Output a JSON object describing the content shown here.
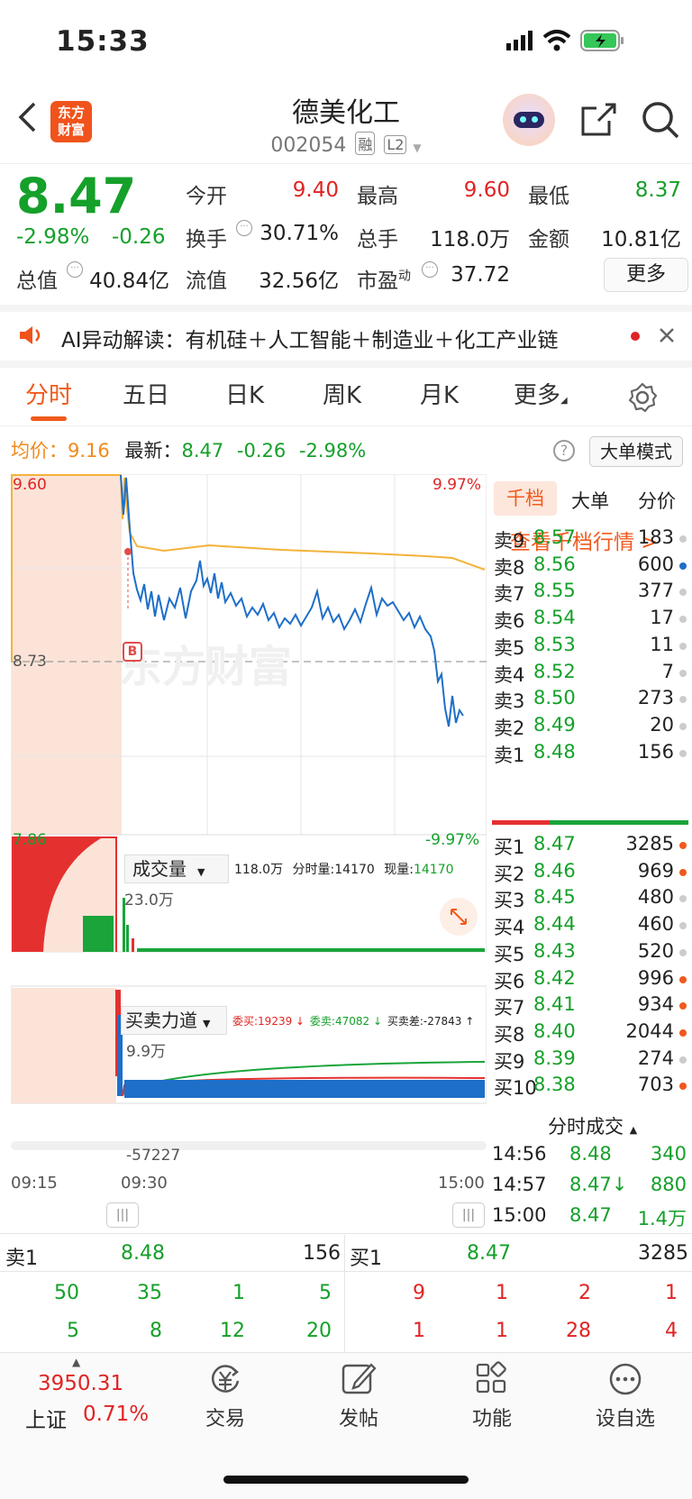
{
  "status": {
    "time": "15:33"
  },
  "header": {
    "logo_line1": "东方",
    "logo_line2": "财富",
    "stock_name": "德美化工",
    "stock_code": "002054",
    "tag_margin": "融",
    "tag_level": "L2"
  },
  "quote": {
    "price": "8.47",
    "change_pct": "-2.98%",
    "change": "-0.26",
    "open_label": "今开",
    "open": "9.40",
    "high_label": "最高",
    "high": "9.60",
    "low_label": "最低",
    "low": "8.37",
    "turnover_label": "换手",
    "turnover": "30.71%",
    "volume_label": "总手",
    "volume": "118.0万",
    "amount_label": "金额",
    "amount": "10.81亿",
    "mktcap_label": "总值",
    "mktcap": "40.84亿",
    "float_label": "流值",
    "float": "32.56亿",
    "pe_label": "市盈",
    "pe_sup": "动",
    "pe": "37.72",
    "more": "更多"
  },
  "ai": {
    "text": "AI异动解读：有机硅＋人工智能＋制造业＋化工产业链"
  },
  "tabs": [
    "分时",
    "五日",
    "日K",
    "周K",
    "月K",
    "更多"
  ],
  "avgline": {
    "avg_label": "均价：",
    "avg": "9.16",
    "latest_label": "最新：",
    "latest": "8.47",
    "chg": "-0.26",
    "pct": "-2.98%",
    "big_order": "大单模式"
  },
  "chart": {
    "y_high": "9.60",
    "y_mid": "8.73",
    "y_low": "7.86",
    "pct_high": "9.97%",
    "pct_low": "-9.97%",
    "watermark": "东方财富",
    "marker": "B",
    "vol_label": "成交量",
    "vol_info_total": "118.0万",
    "vol_info_tick_label": "分时量:",
    "vol_info_tick": "14170",
    "vol_info_now_label": "现量:",
    "vol_info_now": "14170",
    "vol_max": "23.0万",
    "force_label": "买卖力道",
    "force_buy": "委买:19239 ↓",
    "force_sell": "委卖:47082 ↓",
    "force_diff": "买卖差:-27843 ↑",
    "force_max": "9.9万",
    "force_min": "-57227",
    "t_start": "09:15",
    "t_open": "09:30",
    "t_end": "15:00"
  },
  "orderbook": {
    "tabs": [
      "千档",
      "大单",
      "分价"
    ],
    "link": "查看千档行情 >",
    "asks": [
      [
        "卖9",
        "8.57",
        "183"
      ],
      [
        "卖8",
        "8.56",
        "600"
      ],
      [
        "卖7",
        "8.55",
        "377"
      ],
      [
        "卖6",
        "8.54",
        "17"
      ],
      [
        "卖5",
        "8.53",
        "11"
      ],
      [
        "卖4",
        "8.52",
        "7"
      ],
      [
        "卖3",
        "8.50",
        "273"
      ],
      [
        "卖2",
        "8.49",
        "20"
      ],
      [
        "卖1",
        "8.48",
        "156"
      ]
    ],
    "bids": [
      [
        "买1",
        "8.47",
        "3285"
      ],
      [
        "买2",
        "8.46",
        "969"
      ],
      [
        "买3",
        "8.45",
        "480"
      ],
      [
        "买4",
        "8.44",
        "460"
      ],
      [
        "买5",
        "8.43",
        "520"
      ],
      [
        "买6",
        "8.42",
        "996"
      ],
      [
        "买7",
        "8.41",
        "934"
      ],
      [
        "买8",
        "8.40",
        "2044"
      ],
      [
        "买9",
        "8.39",
        "274"
      ],
      [
        "买10",
        "8.38",
        "703"
      ]
    ],
    "ticks_label": "分时成交",
    "ticks": [
      [
        "14:56",
        "8.48",
        "340"
      ],
      [
        "14:57",
        "8.47↓",
        "880"
      ],
      [
        "15:00",
        "8.47",
        "1.4万"
      ]
    ]
  },
  "queue": {
    "ask_label": "卖1",
    "ask_price": "8.48",
    "ask_vol": "156",
    "bid_label": "买1",
    "bid_price": "8.47",
    "bid_vol": "3285",
    "ask_row1": [
      "50",
      "35",
      "1",
      "5"
    ],
    "ask_row2": [
      "5",
      "8",
      "12",
      "20"
    ],
    "bid_row1": [
      "9",
      "1",
      "2",
      "1"
    ],
    "bid_row2": [
      "1",
      "1",
      "28",
      "4"
    ]
  },
  "bottom": {
    "index_value": "3950.31",
    "index_name": "上证",
    "index_pct": "0.71%",
    "trade": "交易",
    "post": "发帖",
    "func": "功能",
    "watch": "设自选"
  }
}
